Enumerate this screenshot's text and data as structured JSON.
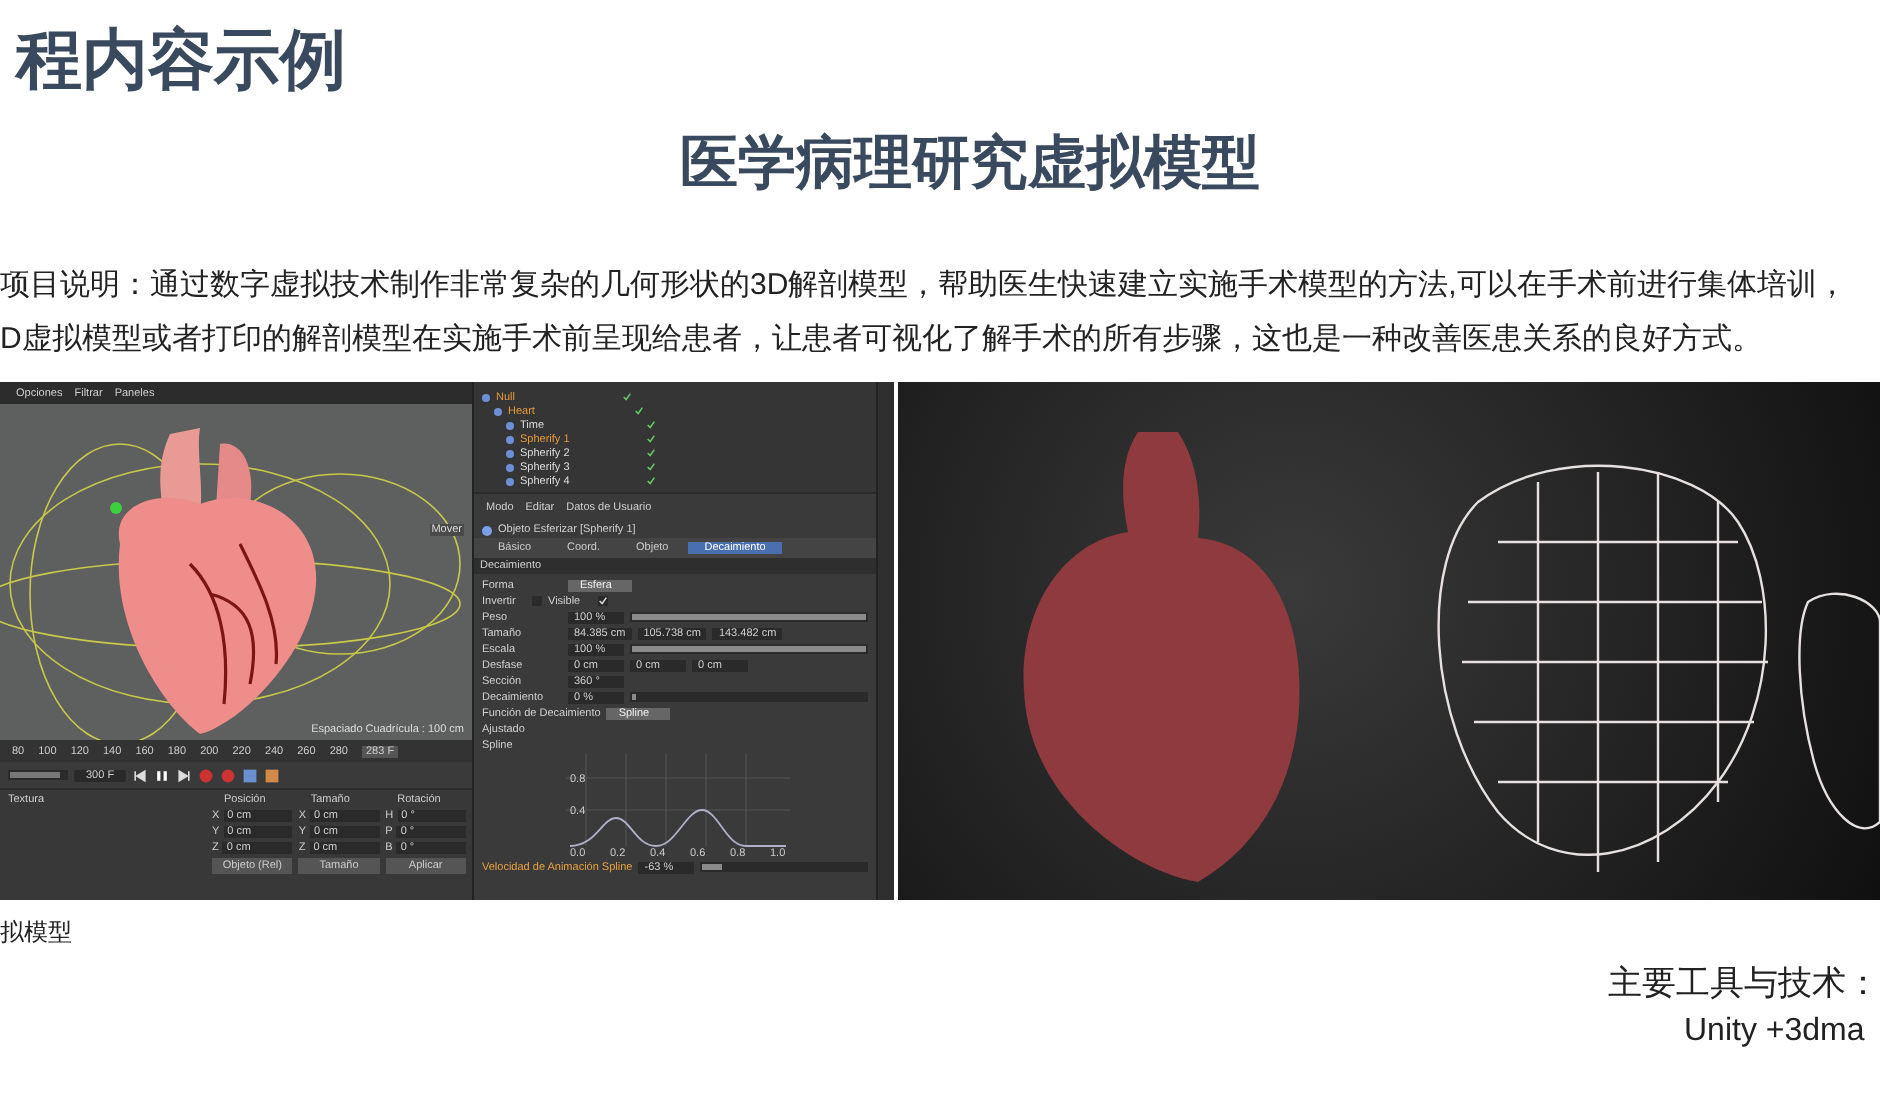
{
  "slide": {
    "title": "程内容示例",
    "subtitle": "医学病理研究虚拟模型",
    "description_lines": [
      "项目说明：通过数字虚拟技术制作非常复杂的几何形状的3D解剖模型，帮助医生快速建立实施手术模型的方法,可以在手术前进行集体培训，",
      "D虚拟模型或者打印的解剖模型在实施手术前呈现给患者，让患者可视化了解手术的所有步骤，这也是一种改善医患关系的良好方式。"
    ],
    "caption": "拟模型",
    "tools_label": "主要工具与技术：",
    "tools": "Unity +3dma"
  },
  "editor_screenshot": {
    "menu": [
      "Opciones",
      "Filtrar",
      "Paneles"
    ],
    "viewport_label": "Mover",
    "grid_spacing": "Espaciado Cuadrícula : 100 cm",
    "timeline": {
      "ticks": [
        "80",
        "100",
        "120",
        "140",
        "160",
        "180",
        "200",
        "220",
        "240",
        "260",
        "280"
      ],
      "current": "283 F"
    },
    "frame_slider": {
      "level": 0.9
    },
    "end_frame": "300 F",
    "coords": {
      "tab": "Textura",
      "headers": [
        "Posición",
        "Tamaño",
        "Rotación"
      ],
      "rows": [
        [
          {
            "axis": "X",
            "value": "0 cm"
          },
          {
            "axis": "X",
            "value": "0 cm"
          },
          {
            "axis": "H",
            "value": "0 °"
          }
        ],
        [
          {
            "axis": "Y",
            "value": "0 cm"
          },
          {
            "axis": "Y",
            "value": "0 cm"
          },
          {
            "axis": "P",
            "value": "0 °"
          }
        ],
        [
          {
            "axis": "Z",
            "value": "0 cm"
          },
          {
            "axis": "Z",
            "value": "0 cm"
          },
          {
            "axis": "B",
            "value": "0 °"
          }
        ]
      ],
      "buttons": [
        "Objeto (Rel)",
        "Tamaño",
        "Aplicar"
      ]
    },
    "objects": [
      {
        "name": "Null",
        "selected": true,
        "children": [
          {
            "name": "Heart",
            "selected": true,
            "children": [
              {
                "name": "Time",
                "selected": false
              },
              {
                "name": "Spherify 1",
                "selected": true
              },
              {
                "name": "Spherify 2",
                "selected": false
              },
              {
                "name": "Spherify 3",
                "selected": false
              },
              {
                "name": "Spherify 4",
                "selected": false
              }
            ]
          }
        ]
      }
    ],
    "attr_menu": [
      "Modo",
      "Editar",
      "Datos de Usuario"
    ],
    "object_title": "Objeto Esferizar [Spherify 1]",
    "tabs": [
      {
        "label": "Básico",
        "selected": false
      },
      {
        "label": "Coord.",
        "selected": false
      },
      {
        "label": "Objeto",
        "selected": false
      },
      {
        "label": "Decaimiento",
        "selected": true
      }
    ],
    "section": "Decaimiento",
    "properties": [
      {
        "kind": "dropdown",
        "label": "Forma",
        "value": "Esfera"
      },
      {
        "kind": "checks",
        "items": [
          {
            "label": "Invertir",
            "checked": false
          },
          {
            "label": "Visible",
            "checked": true
          }
        ]
      },
      {
        "kind": "slider",
        "label": "Peso",
        "value": "100 %",
        "level": 1,
        "keyed": false
      },
      {
        "kind": "vector",
        "label": "Tamaño",
        "values": [
          "84.385 cm",
          "105.738 cm",
          "143.482 cm"
        ]
      },
      {
        "kind": "slider",
        "label": "Escala",
        "value": "100 %",
        "level": 1,
        "keyed": false
      },
      {
        "kind": "vector",
        "label": "Desfase",
        "values": [
          "0 cm",
          "0 cm",
          "0 cm"
        ]
      },
      {
        "kind": "number",
        "label": "Sección",
        "value": "360 °"
      },
      {
        "kind": "slider",
        "label": "Decaimiento",
        "value": "0 %",
        "level": 0,
        "keyed": false
      },
      {
        "kind": "dropdown",
        "label": "Función de Decaimiento",
        "value": "Spline"
      },
      {
        "kind": "label",
        "label": "Ajustado"
      },
      {
        "kind": "label",
        "label": "Spline"
      },
      {
        "kind": "graph",
        "y_labels": [
          "0.8",
          "0.4"
        ],
        "x_labels": [
          "0.0",
          "0.2",
          "0.4",
          "0.6",
          "0.8",
          "1.0"
        ]
      },
      {
        "kind": "slider",
        "label": "Velocidad de Animación Spline",
        "value": "-63 %",
        "level": 0.12,
        "keyed": true
      }
    ]
  }
}
